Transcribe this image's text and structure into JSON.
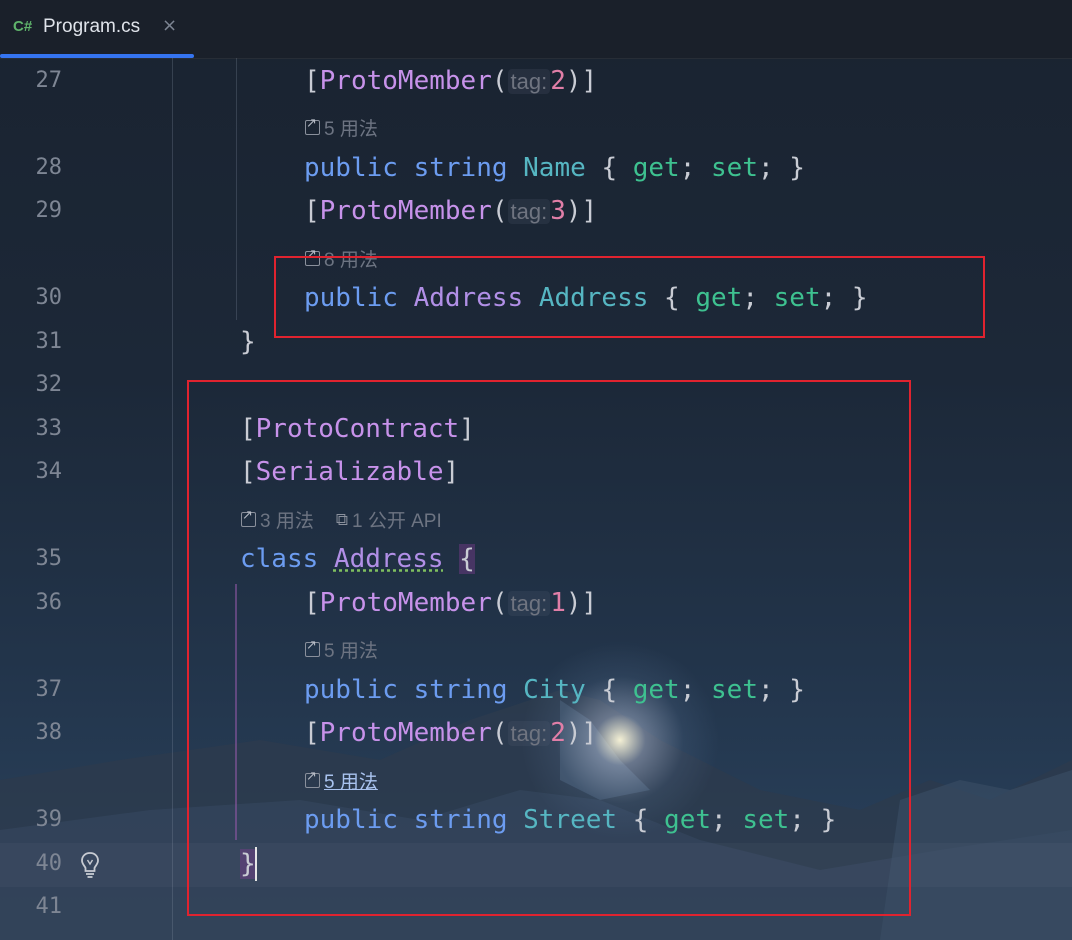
{
  "tab": {
    "lang_badge": "C#",
    "file_name": "Program.cs",
    "close_glyph": "×",
    "accent_color": "#3574f0"
  },
  "lines": [
    {
      "no": "27",
      "code": "[ProtoMember(tag: 2)]"
    },
    {
      "no": "28",
      "code": "public string Name { get; set; }"
    },
    {
      "no": "29",
      "code": "[ProtoMember(tag: 3)]"
    },
    {
      "no": "30",
      "code": "public Address Address { get; set; }"
    },
    {
      "no": "31",
      "code": "}"
    },
    {
      "no": "32",
      "code": ""
    },
    {
      "no": "33",
      "code": "[ProtoContract]"
    },
    {
      "no": "34",
      "code": "[Serializable]"
    },
    {
      "no": "35",
      "code": "class Address {"
    },
    {
      "no": "36",
      "code": "[ProtoMember(tag: 1)]"
    },
    {
      "no": "37",
      "code": "public string City { get; set; }"
    },
    {
      "no": "38",
      "code": "[ProtoMember(tag: 2)]"
    },
    {
      "no": "39",
      "code": "public string Street { get; set; }"
    },
    {
      "no": "40",
      "code": "}"
    },
    {
      "no": "41",
      "code": ""
    }
  ],
  "tokens": {
    "public": "public",
    "string": "string",
    "class": "class",
    "get": "get",
    "set": "set",
    "proto_member": "ProtoMember",
    "proto_contract": "ProtoContract",
    "serializable": "Serializable",
    "tag_hint": "tag:",
    "name_prop": "Name",
    "address_type": "Address",
    "address_prop": "Address",
    "city_prop": "City",
    "street_prop": "Street",
    "tag1": "1",
    "tag2": "2",
    "tag3": "3"
  },
  "lenses": {
    "name_usages": "5 用法",
    "address_usages": "8 用法",
    "class_usages": "3 用法",
    "class_public_api": "1 公开 API",
    "city_usages": "5 用法",
    "street_usages": "5 用法"
  },
  "highlight_color": "#e0232f",
  "icons": {
    "tab_close": "close-icon",
    "usages": "arrow-up-right-icon",
    "public_api": "puzzle-icon",
    "intention": "lightbulb-icon"
  }
}
